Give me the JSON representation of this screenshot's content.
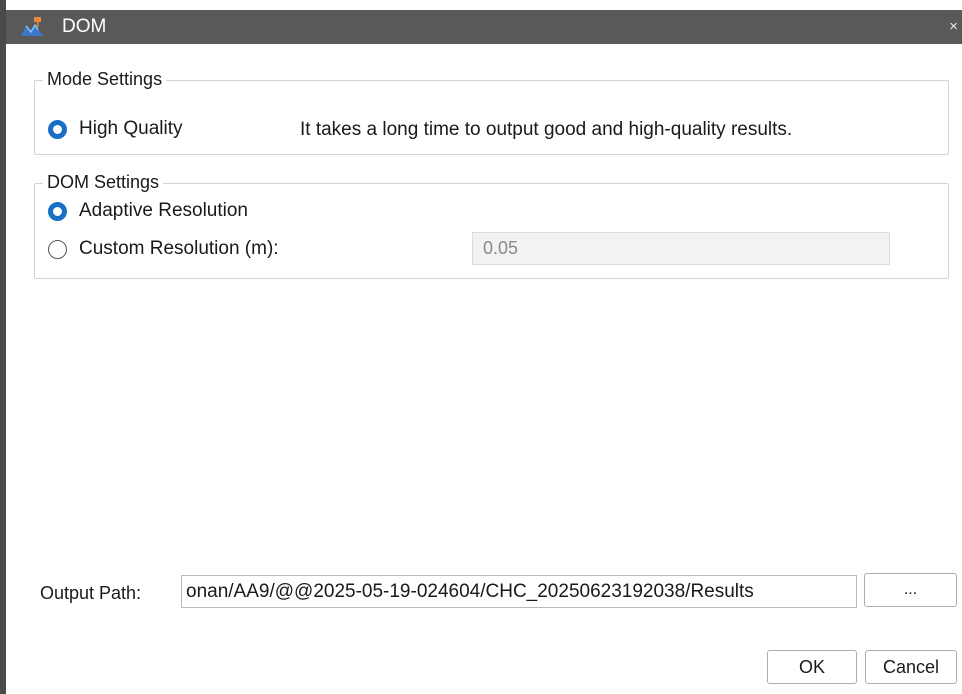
{
  "window": {
    "title": "DOM",
    "close_glyph": "×"
  },
  "mode_settings": {
    "legend": "Mode Settings",
    "option_label": "High Quality",
    "option_checked": true,
    "description": "It takes a long time to output good and high-quality results."
  },
  "dom_settings": {
    "legend": "DOM Settings",
    "adaptive_label": "Adaptive Resolution",
    "adaptive_checked": true,
    "custom_label": "Custom Resolution (m):",
    "custom_checked": false,
    "custom_value": "0.05"
  },
  "output": {
    "label": "Output Path:",
    "path": "onan/AA9/@@2025-05-19-024604/CHC_20250623192038/Results",
    "browse_label": "..."
  },
  "buttons": {
    "ok": "OK",
    "cancel": "Cancel"
  },
  "colors": {
    "titlebar": "#595959",
    "accent": "#1a6fc4"
  }
}
